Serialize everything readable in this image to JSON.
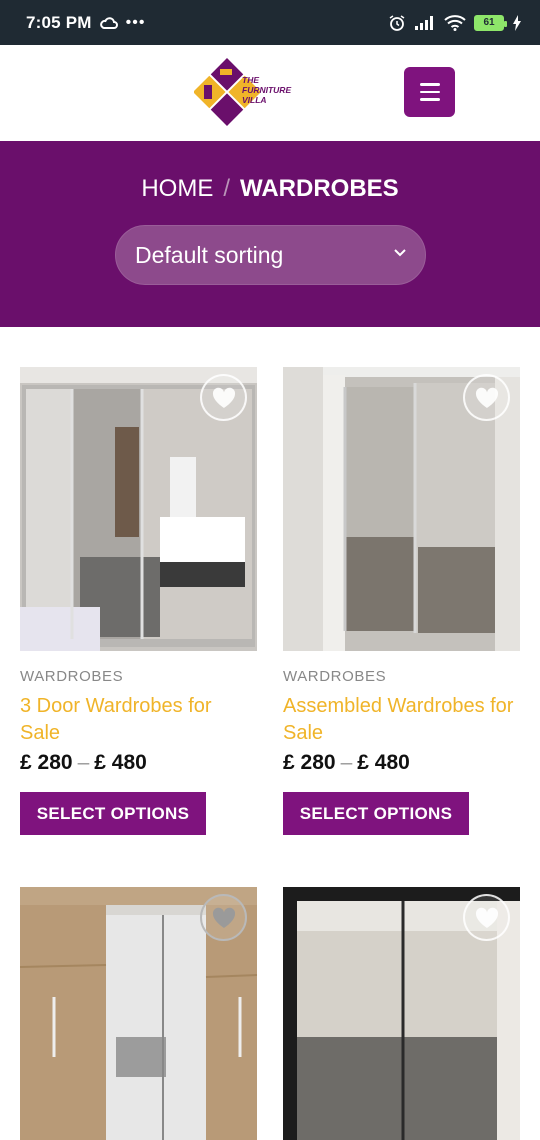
{
  "status_bar": {
    "time": "7:05 PM",
    "battery": "61"
  },
  "header": {
    "logo_text": [
      "THE",
      "FURNITURE",
      "VILLA"
    ]
  },
  "banner": {
    "breadcrumb_home": "HOME",
    "breadcrumb_sep": "/",
    "breadcrumb_current": "WARDROBES",
    "sort_selected": "Default sorting"
  },
  "products": [
    {
      "category": "WARDROBES",
      "name": "3 Door Wardrobes for Sale",
      "price_min": "£ 280",
      "price_max": "£ 480",
      "button": "SELECT OPTIONS"
    },
    {
      "category": "WARDROBES",
      "name": "Assembled Wardrobes for Sale",
      "price_min": "£ 280",
      "price_max": "£ 480",
      "button": "SELECT OPTIONS"
    },
    {
      "category": "",
      "name": "",
      "price_min": "",
      "price_max": "",
      "button": ""
    },
    {
      "category": "",
      "name": "",
      "price_min": "",
      "price_max": "",
      "button": ""
    }
  ],
  "colors": {
    "brand_purple": "#6a0f6b",
    "button_purple": "#7f137e",
    "product_name": "#f0b429"
  }
}
